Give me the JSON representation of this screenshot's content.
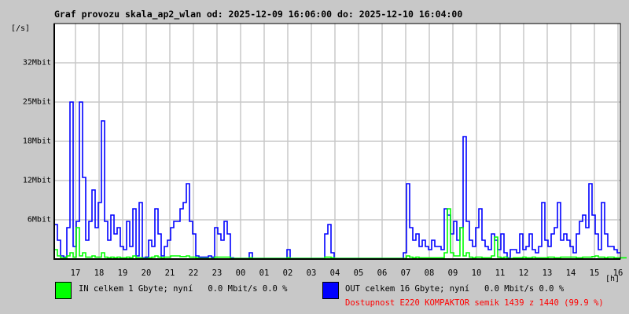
{
  "title": "Graf provozu skala_ap2_wlan od: 2025-12-09 16:06:00 do: 2025-12-10 16:04:00",
  "colors": {
    "background": "#c8c8c8",
    "plot": "#ffffff",
    "grid": "#c8c8c8",
    "in": "#00ff00",
    "out": "#0000ff",
    "availability": "#ff0000"
  },
  "chart_data": {
    "type": "line",
    "title": "Graf provozu skala_ap2_wlan od: 2025-12-09 16:06:00 do: 2025-12-10 16:04:00",
    "ylabel": "[/s]",
    "xlabel": "[h]",
    "ylim": [
      0,
      37.5
    ],
    "yunit": "Mbit/s",
    "yticks": [
      {
        "value": 6.25,
        "label": "6Mbit"
      },
      {
        "value": 12.5,
        "label": "12Mbit"
      },
      {
        "value": 18.75,
        "label": "18Mbit"
      },
      {
        "value": 25,
        "label": "25Mbit"
      },
      {
        "value": 31.25,
        "label": "32Mbit"
      }
    ],
    "xrange_hours": [
      0,
      24
    ],
    "x_start": "16:06",
    "xticks": [
      "17",
      "18",
      "19",
      "20",
      "21",
      "22",
      "23",
      "00",
      "01",
      "02",
      "03",
      "04",
      "05",
      "06",
      "07",
      "08",
      "09",
      "10",
      "11",
      "12",
      "13",
      "14",
      "15",
      "16"
    ],
    "first_tick_offset_hours": 0.9,
    "grid": true,
    "sample_minutes": 8,
    "series": [
      {
        "name": "OUT",
        "color": "#0000ff",
        "values": [
          5.5,
          3,
          0.5,
          0.3,
          5,
          25,
          2,
          6,
          25,
          13,
          3,
          6,
          11,
          5,
          9,
          22,
          6,
          3,
          7,
          4,
          5,
          2,
          1.5,
          6,
          2,
          8,
          0.5,
          9,
          0.2,
          0.3,
          3,
          2,
          8,
          4,
          0.5,
          2,
          3,
          5,
          6,
          6,
          8,
          9,
          12,
          6,
          4,
          0.5,
          0.3,
          0.3,
          0.3,
          0.5,
          0.3,
          5,
          4,
          3,
          6,
          4,
          0.2,
          0.1,
          0.1,
          0.1,
          0.1,
          0.1,
          1,
          0.1,
          0.1,
          0.1,
          0.1,
          0.1,
          0.1,
          0.1,
          0.1,
          0.1,
          0.1,
          0.1,
          1.5,
          0.1,
          0.1,
          0.1,
          0.1,
          0.1,
          0.1,
          0.1,
          0.1,
          0.1,
          0.1,
          0.1,
          4,
          5.5,
          1,
          0.1,
          0.1,
          0.1,
          0.1,
          0.1,
          0.1,
          0.1,
          0.1,
          0.1,
          0.1,
          0.1,
          0.1,
          0.1,
          0.1,
          0.1,
          0.1,
          0.1,
          0.1,
          0.1,
          0.1,
          0.1,
          0.1,
          1,
          12,
          5,
          3,
          4,
          2,
          3,
          2,
          1.5,
          3,
          2,
          2,
          1.5,
          8,
          7,
          4,
          6,
          3,
          5,
          19.5,
          6,
          3,
          2,
          5,
          8,
          3,
          2,
          1.5,
          4,
          3,
          1.5,
          4,
          1,
          0.2,
          1.5,
          1.5,
          1,
          4,
          1.5,
          2,
          4,
          1.5,
          1,
          2,
          9,
          3,
          2,
          4,
          5,
          9,
          3,
          4,
          3,
          2,
          1,
          4,
          6,
          7,
          5,
          12,
          7,
          4,
          1.5,
          9,
          4,
          2,
          2,
          1.5,
          1
        ]
      },
      {
        "name": "IN",
        "color": "#00ff00",
        "values": [
          1.5,
          0.5,
          0.2,
          0.2,
          0.5,
          1,
          0.3,
          5,
          0.5,
          1,
          0.3,
          0.3,
          0.5,
          0.3,
          0.3,
          1,
          0.3,
          0.2,
          0.3,
          0.2,
          0.3,
          0.2,
          0.2,
          0.3,
          0.2,
          0.5,
          0.2,
          0.2,
          0.1,
          0.1,
          0.2,
          0.3,
          0.5,
          0.3,
          0.2,
          0.3,
          0.3,
          0.5,
          0.5,
          0.5,
          0.4,
          0.4,
          0.5,
          0.3,
          0.3,
          0.2,
          0.1,
          0.1,
          0.1,
          0.1,
          0.1,
          0.3,
          0.3,
          0.3,
          0.3,
          0.3,
          0.1,
          0.1,
          0.1,
          0.1,
          0.1,
          0.1,
          0.2,
          0.1,
          0.1,
          0.1,
          0.1,
          0.1,
          0.1,
          0.1,
          0.1,
          0.1,
          0.1,
          0.1,
          0.2,
          0.1,
          0.1,
          0.1,
          0.1,
          0.1,
          0.1,
          0.1,
          0.1,
          0.1,
          0.1,
          0.1,
          0.3,
          0.3,
          0.2,
          0.1,
          0.1,
          0.1,
          0.1,
          0.1,
          0.1,
          0.1,
          0.1,
          0.1,
          0.1,
          0.1,
          0.1,
          0.1,
          0.1,
          0.1,
          0.1,
          0.1,
          0.1,
          0.1,
          0.1,
          0.1,
          0.1,
          0.1,
          0.5,
          0.3,
          0.2,
          0.3,
          0.2,
          0.2,
          0.2,
          0.2,
          0.2,
          0.2,
          0.2,
          0.2,
          1,
          8,
          1,
          0.5,
          0.5,
          5,
          0.5,
          1,
          0.3,
          0.2,
          0.3,
          0.3,
          0.2,
          0.2,
          0.2,
          0.5,
          3.5,
          0.3,
          0.2,
          0.3,
          0.1,
          0.1,
          0.2,
          0.2,
          0.2,
          0.3,
          0.2,
          0.2,
          0.3,
          0.2,
          0.2,
          0.2,
          0.2,
          0.3,
          0.3,
          0.2,
          0.2,
          0.3,
          0.3,
          0.3,
          0.3,
          0.3,
          0.2,
          0.2,
          0.3,
          0.3,
          0.3,
          0.4,
          0.5,
          0.3,
          0.3,
          0.2,
          0.3,
          0.3,
          0.2,
          0.2,
          0.2,
          0.2
        ]
      }
    ]
  },
  "legend": {
    "in": "IN celkem 1 Gbyte; nyní   0.0 Mbit/s 0.0 %",
    "out": "OUT celkem 16 Gbyte; nyní   0.0 Mbit/s 0.0 %",
    "availability": "Dostupnost E220 KOMPAKTOR semik 1439 z 1440 (99.9 %)"
  }
}
